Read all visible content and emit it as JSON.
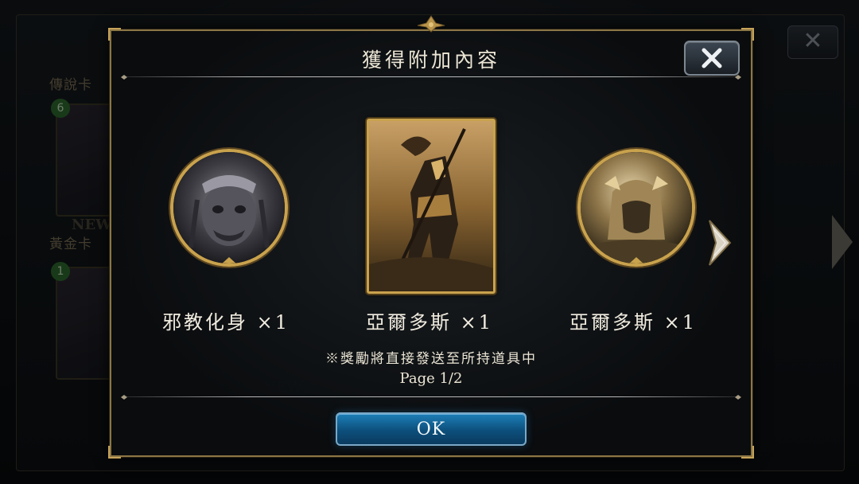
{
  "background": {
    "section_legend": "傳說卡",
    "section_gold": "黃金卡",
    "new_badge": "NEW",
    "close_glyph": "✕",
    "card_costs": [
      "6",
      "1"
    ]
  },
  "dialog": {
    "title": "獲得附加內容",
    "close_icon": "close-icon",
    "rewards": [
      {
        "label": "邪教化身 ×1",
        "style": "medallion"
      },
      {
        "label": "亞爾多斯 ×1",
        "style": "card"
      },
      {
        "label": "亞爾多斯 ×1",
        "style": "medallion"
      }
    ],
    "notice": "※獎勵將直接發送至所持道具中",
    "page": "Page 1/2",
    "ok_label": "OK"
  },
  "colors": {
    "gold_frame": "#c9a24d",
    "ok_button": "#1d7fb8",
    "text": "#ece6d6"
  }
}
